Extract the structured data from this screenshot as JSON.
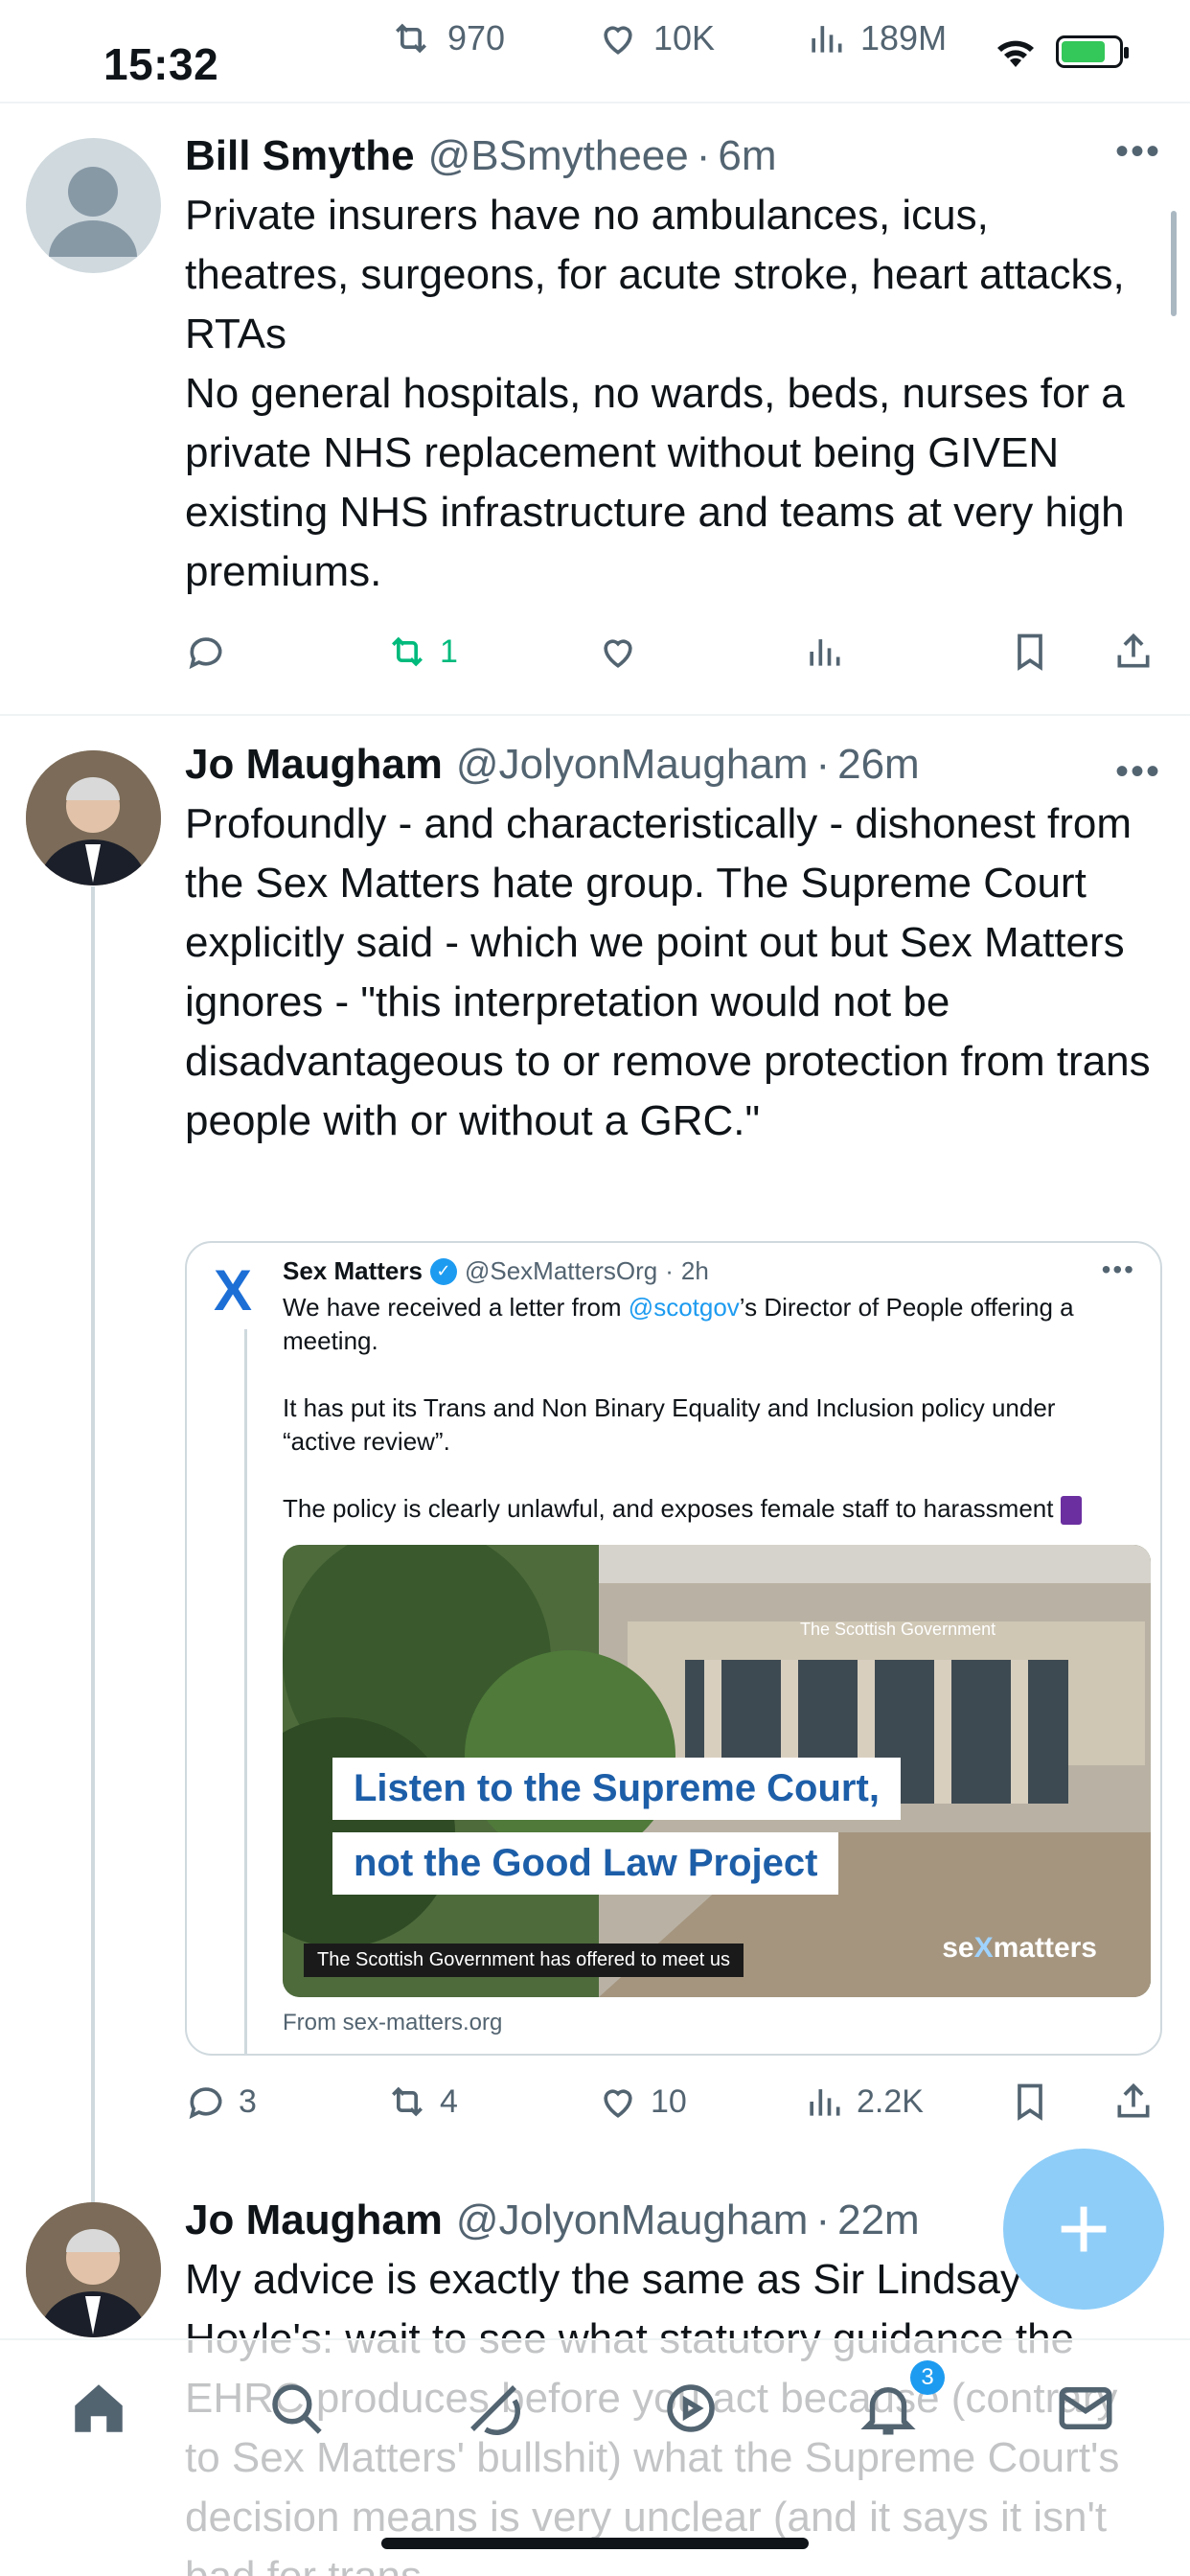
{
  "status_bar": {
    "time": "15:32"
  },
  "top_engagement": {
    "retweets": "970",
    "likes": "10K",
    "views": "189M"
  },
  "tweets": [
    {
      "name": "Bill Smythe",
      "handle": "@BSmytheee",
      "time": "6m",
      "text": "Private insurers have no ambulances, icus, theatres, surgeons, for acute stroke, heart attacks, RTAs\nNo general hospitals, no wards, beds, nurses for a private NHS replacement without being GIVEN existing NHS infrastructure and teams at very high premiums.",
      "replies": "",
      "retweets": "1",
      "likes": "",
      "views": ""
    },
    {
      "name": "Jo Maugham",
      "handle": "@JolyonMaugham",
      "time": "26m",
      "text": "Profoundly - and characteristically - dishonest from the Sex Matters hate group. The Supreme Court explicitly said - which we point out but Sex Matters ignores - \"this interpretation would not be disadvantageous to or remove protection from trans people with or without a GRC.\"",
      "replies": "3",
      "retweets": "4",
      "likes": "10",
      "views": "2.2K",
      "quote": {
        "name": "Sex Matters",
        "handle": "@SexMattersOrg",
        "time": "2h",
        "text_before": "We have received a letter from ",
        "mention": "@scotgov",
        "text_after": "’s Director of People offering a meeting.\n\nIt has put its Trans and Non Binary Equality and Inclusion policy under “active review”.\n\nThe policy is clearly unlawful, and exposes female staff to harassment",
        "image": {
          "building_sign": "The Scottish Government",
          "headline_1": "Listen to the Supreme Court,",
          "headline_2": "not the Good Law Project",
          "caption": "The Scottish Government has offered to meet us",
          "brand_start": "se",
          "brand_x": "X",
          "brand_end": "matters"
        },
        "source": "From sex-matters.org"
      }
    },
    {
      "name": "Jo Maugham",
      "handle": "@JolyonMaugham",
      "time": "22m",
      "text": "My advice is exactly the same as Sir Lindsay Hoyle's: wait to see what statutory guidance the EHRC produces before you act because (contrary to Sex Matters' bullshit) what the Supreme Court's decision means is very unclear (and it says it isn't bad for trans"
    }
  ],
  "nav": {
    "notifications_badge": "3"
  },
  "colors": {
    "accent": "#1d9bf0",
    "retweet_green": "#00ba7c",
    "muted": "#536471"
  }
}
